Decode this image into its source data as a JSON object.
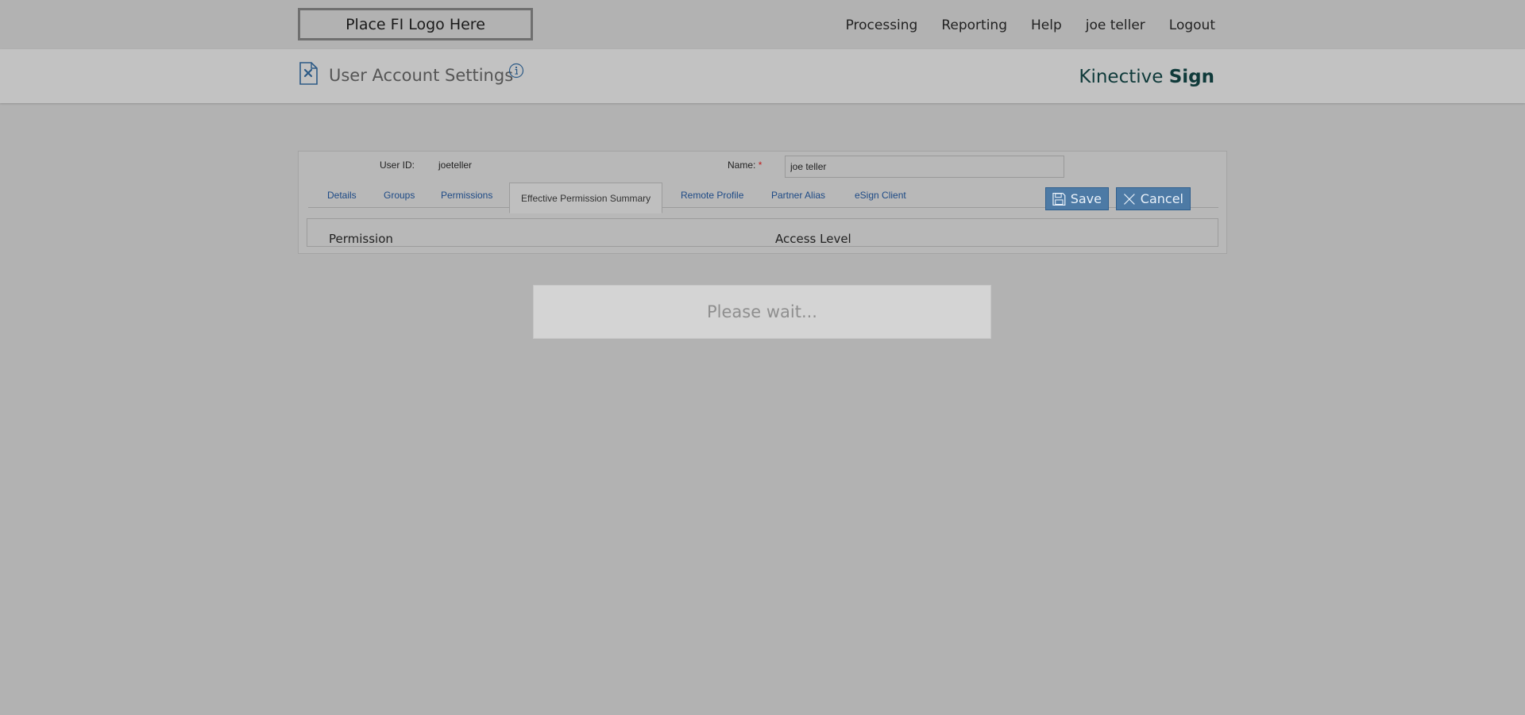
{
  "topbar": {
    "logo_text": "Place FI Logo Here",
    "nav": {
      "processing": "Processing",
      "reporting": "Reporting",
      "help": "Help",
      "user": "joe teller",
      "logout": "Logout"
    }
  },
  "header": {
    "title": "User Account Settings",
    "brand_light": "Kinective",
    "brand_bold": "Sign",
    "icons": [
      "document-settings-icon",
      "info-icon"
    ]
  },
  "form": {
    "user_id_label": "User ID:",
    "user_id_value": "joeteller",
    "name_label": "Name:",
    "name_required_mark": "*",
    "name_value": "joe teller"
  },
  "tabs": {
    "details": "Details",
    "groups": "Groups",
    "permissions": "Permissions",
    "effective_permission_summary": "Effective Permission Summary",
    "remote_profile": "Remote Profile",
    "partner_alias": "Partner Alias",
    "esign_client": "eSign Client",
    "active": "Effective Permission Summary"
  },
  "actions": {
    "save_label": "Save",
    "cancel_label": "Cancel"
  },
  "table": {
    "columns": {
      "permission": "Permission",
      "access_level": "Access Level"
    }
  },
  "overlay": {
    "message": "Please wait..."
  },
  "colors": {
    "page_bg": "#b2b2b2",
    "header_band": "#c2c2c2",
    "tab_link": "#1d4a86",
    "button_bg": "#4d7aa5",
    "brand_text": "#0f3a3a",
    "required": "#c01c1c"
  }
}
